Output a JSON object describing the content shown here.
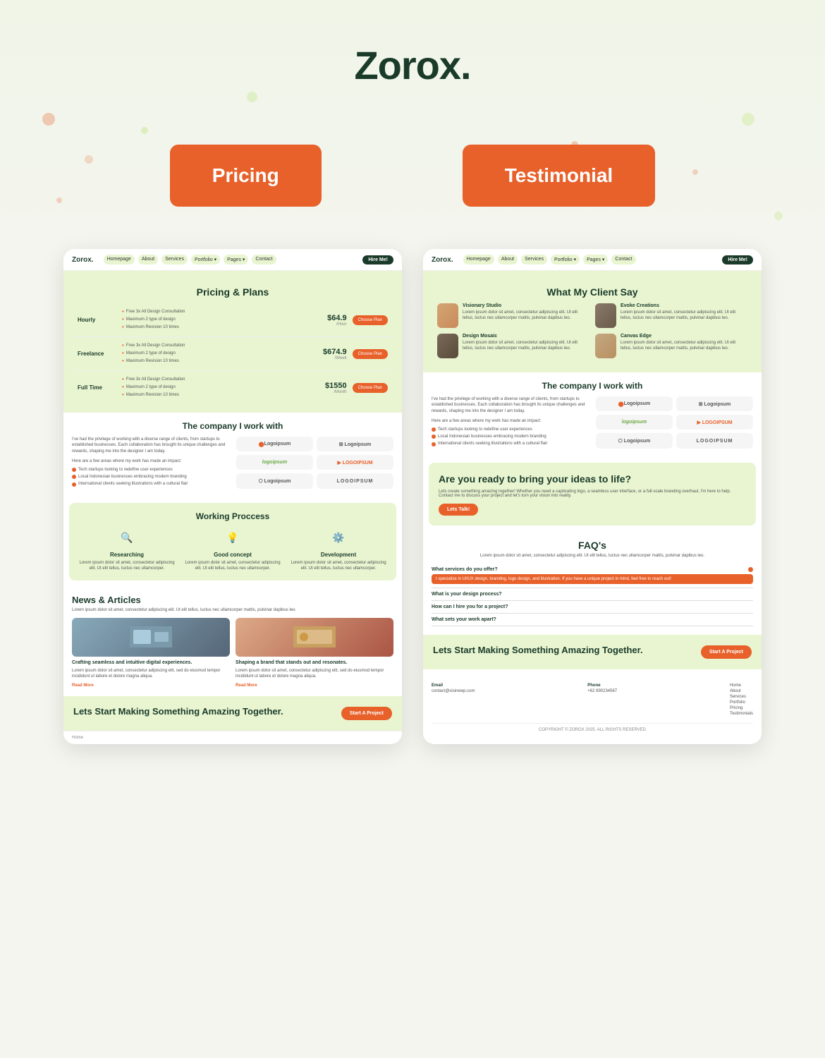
{
  "header": {
    "logo": "Zorox.",
    "period": "."
  },
  "hero": {
    "pricing_label": "Pricing",
    "testimonial_label": "Testimonial"
  },
  "left_screenshot": {
    "nav": {
      "logo": "Zorox.",
      "links": [
        "Homepage",
        "About",
        "Services",
        "Portfolio ▾",
        "Pages ▾",
        "Contact"
      ],
      "cta": "Hire Me!"
    },
    "pricing": {
      "title": "Pricing & Plans",
      "rows": [
        {
          "type": "Hourly",
          "features": [
            "Free 3x All Design Consultation",
            "Maximum 2 type of design",
            "Maximum Revision 10 times"
          ],
          "price": "$64.9",
          "period": "/Hour",
          "btn": "Choose Plan"
        },
        {
          "type": "Freelance",
          "features": [
            "Free 3x All Design Consultation",
            "Maximum 2 type of design",
            "Maximum Revision 10 times"
          ],
          "price": "$674.9",
          "period": "/Week",
          "btn": "Choose Plan"
        },
        {
          "type": "Full Time",
          "features": [
            "Free 3x All Design Consultation",
            "Maximum 2 type of design",
            "Maximum Revision 10 times"
          ],
          "price": "$1550",
          "period": "/Month",
          "btn": "Choose Plan"
        }
      ]
    },
    "company": {
      "title": "The company I work with",
      "text": "I've had the privilege of working with a diverse range of clients, from startups to established businesses. Each collaboration has brought its unique challenges and rewards, shaping me into the designer I am today.",
      "bullets_label": "Here are a few areas where my work has made an impact:",
      "bullets": [
        "Tech startups looking to redefine user experiences",
        "Local Indonesian businesses embracing modern branding",
        "International clients seeking illustrations with a cultural flair"
      ],
      "logos": [
        "Logoipsum",
        "Logoipsum",
        "logoipsum",
        "LOGOIPSUM",
        "Logoipsum",
        "LOGOIPSUM"
      ]
    },
    "working": {
      "title": "Working Proccess",
      "items": [
        {
          "icon": "🔍",
          "title": "Researching",
          "desc": "Lorem ipsum dolor sit amet, consectetur adipiscing elit. Ut elit tellus, luctus nec ullamcorper."
        },
        {
          "icon": "💡",
          "title": "Good concept",
          "desc": "Lorem ipsum dolor sit amet, consectetur adipiscing elit. Ut elit tellus, luctus nec ullamcorper."
        },
        {
          "icon": "⚙️",
          "title": "Development",
          "desc": "Lorem ipsum dolor sit amet, consectetur adipiscing elit. Ut elit tellus, luctus nec ullamcorper."
        }
      ]
    },
    "news": {
      "title": "News & Articles",
      "desc": "Lorem ipsum dolor sit amet, consectetur adipiscing elit. Ut elit tellus, luctus nec ullamcorper mattis, pulvinar dapibus leo.",
      "articles": [
        {
          "title": "Crafting seamless and intuitive digital experiences.",
          "desc": "Lorem ipsum dolor sit amet, consectetur adipiscing elit, sed do eiusmod tempor incididunt ut labore et dolore magna aliqua.",
          "read_more": "Read More"
        },
        {
          "title": "Shaping a brand that stands out and resonates.",
          "desc": "Lorem ipsum dolor sit amet, consectetur adipiscing elit, sed do eiusmod tempor incididunt ut labore et dolore magna aliqua.",
          "read_more": "Read More"
        }
      ]
    },
    "footer_cta": {
      "title": "Lets Start Making Something Amazing Together.",
      "btn": "Start A Project"
    },
    "footer_nav": [
      "Home"
    ]
  },
  "right_screenshot": {
    "nav": {
      "logo": "Zorox.",
      "links": [
        "Homepage",
        "About",
        "Services",
        "Portfolio ▾",
        "Pages ▾",
        "Contact"
      ],
      "cta": "Hire Me!"
    },
    "testimonial": {
      "title": "What My Client Say",
      "cards": [
        {
          "name": "Visionary Studio",
          "text": "Lorem ipsum dolor sit amet, consectetur adipiscing elit. Ut elit tellus, luctus nec ullamcorper mattis, pulvinar dapibus leo."
        },
        {
          "name": "Evoke Creations",
          "text": "Lorem ipsum dolor sit amet, consectetur adipiscing elit. Ut elit tellus, luctus nec ullamcorper mattis, pulvinar dapibus leo."
        },
        {
          "name": "Design Mosaic",
          "text": "Lorem ipsum dolor sit amet, consectetur adipiscing elit. Ut elit tellus, luctus nec ullamcorper mattis, pulvinar dapibus leo."
        },
        {
          "name": "Canvas Edge",
          "text": "Lorem ipsum dolor sit amet, consectetur adipiscing elit. Ut elit tellus, luctus nec ullamcorper mattis, pulvinar dapibus leo."
        }
      ]
    },
    "company": {
      "title": "The company I work with",
      "text": "I've had the privilege of working with a diverse range of clients, from startups to established businesses. Each collaboration has brought its unique challenges and rewards, shaping me into the designer I am today.",
      "bullets_label": "Here are a few areas where my work has made an impact:",
      "bullets": [
        "Tech startups looking to redefine user experiences",
        "Local Indonesian businesses embracing modern branding",
        "International clients seeking illustrations with a cultural flair"
      ],
      "logos": [
        "Logoipsum",
        "Logoipsum",
        "logoipsum",
        "LOGOIPSUM",
        "Logoipsum",
        "LOGOIPSUM"
      ]
    },
    "ready": {
      "title": "Are you ready to bring your ideas to life?",
      "desc": "Lets create something amazing together! Whether you need a captivating logo, a seamless user interface, or a full-scale branding overhaul, I'm here to help. Contact me to discuss your project and let's turn your vision into reality.",
      "btn": "Lets Talk!"
    },
    "faq": {
      "title": "FAQ's",
      "desc": "Lorem ipsum dolor sit amet, consectetur adipiscing elit. Ut elit tellus, luctus nec ullamcorper mattis, pulvinar dapibus leo.",
      "items": [
        {
          "question": "What services do you offer?",
          "answer": "I specialize in UI/UX design, branding, logo design, and illustration. If you have a unique project in mind, feel free to reach out!",
          "open": true
        },
        {
          "question": "What is your design process?",
          "open": false
        },
        {
          "question": "How can I hire you for a project?",
          "open": false
        },
        {
          "question": "What sets your work apart?",
          "open": false
        }
      ]
    },
    "footer_cta": {
      "title": "Lets Start Making Something Amazing Together.",
      "btn": "Start A Project"
    },
    "footer": {
      "email_label": "Email",
      "email": "contact@sisinewp.com",
      "phone_label": "Phone",
      "phone": "+62 890234567",
      "nav_links": [
        "Home",
        "About",
        "Services",
        "Portfolio",
        "Pricing",
        "Testimonials"
      ],
      "copyright": "COPYRIGHT © ZOROX 2025. ALL RIGHTS RESERVED"
    }
  }
}
